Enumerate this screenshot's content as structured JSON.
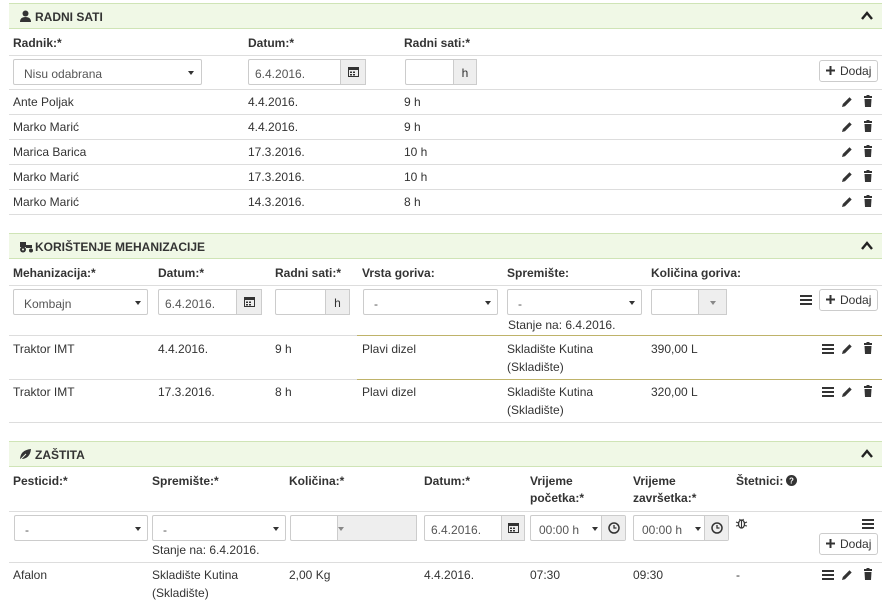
{
  "radni": {
    "title": "RADNI SATI",
    "cols": {
      "radnik": "Radnik:*",
      "datum": "Datum:*",
      "sati": "Radni sati:*"
    },
    "form": {
      "radnik": "Nisu odabrana",
      "datum": "6.4.2016.",
      "sati_value": "",
      "unit": "h",
      "add": "Dodaj"
    },
    "rows": [
      {
        "ime": "Ante Poljak",
        "datum": "4.4.2016.",
        "sati": "9 h"
      },
      {
        "ime": "Marko Marić",
        "datum": "4.4.2016.",
        "sati": "9 h"
      },
      {
        "ime": "Marica Barica",
        "datum": "17.3.2016.",
        "sati": "10 h"
      },
      {
        "ime": "Marko Marić",
        "datum": "17.3.2016.",
        "sati": "10 h"
      },
      {
        "ime": "Marko Marić",
        "datum": "14.3.2016.",
        "sati": "8 h"
      }
    ]
  },
  "meh": {
    "title": "KORIŠTENJE MEHANIZACIJE",
    "cols": {
      "meh": "Mehanizacija:*",
      "datum": "Datum:*",
      "sati": "Radni sati:*",
      "vrsta": "Vrsta goriva:",
      "spremiste": "Spremište:",
      "kolicina": "Količina goriva:"
    },
    "form": {
      "meh": "Kombajn",
      "datum": "6.4.2016.",
      "unit": "h",
      "vrsta": "-",
      "spremiste": "-",
      "stanje": "Stanje na: 6.4.2016.",
      "add": "Dodaj"
    },
    "rows": [
      {
        "meh": "Traktor IMT",
        "datum": "4.4.2016.",
        "sati": "9 h",
        "vrsta": "Plavi dizel",
        "spremiste1": "Skladište Kutina",
        "spremiste2": "(Skladište)",
        "kolicina": "390,00 L"
      },
      {
        "meh": "Traktor IMT",
        "datum": "17.3.2016.",
        "sati": "8 h",
        "vrsta": "Plavi dizel",
        "spremiste1": "Skladište Kutina",
        "spremiste2": "(Skladište)",
        "kolicina": "320,00 L"
      }
    ]
  },
  "zastita": {
    "title": "ZAŠTITA",
    "cols": {
      "pesticid": "Pesticid:*",
      "spremiste": "Spremište:*",
      "kolicina": "Količina:*",
      "datum": "Datum:*",
      "vp1": "Vrijeme",
      "vp2": "početka:*",
      "vz1": "Vrijeme",
      "vz2": "završetka:*",
      "stetnici": "Štetnici:"
    },
    "form": {
      "pesticid": "-",
      "spremiste": "-",
      "stanje": "Stanje na: 6.4.2016.",
      "datum": "6.4.2016.",
      "vp": "00:00 h",
      "vz": "00:00 h",
      "add": "Dodaj"
    },
    "rows": [
      {
        "pesticid": "Afalon",
        "spremiste1": "Skladište Kutina",
        "spremiste2": "(Skladište)",
        "kolicina": "2,00 Kg",
        "datum": "4.4.2016.",
        "vp": "07:30",
        "vz": "09:30",
        "stetnici": "-"
      }
    ]
  }
}
